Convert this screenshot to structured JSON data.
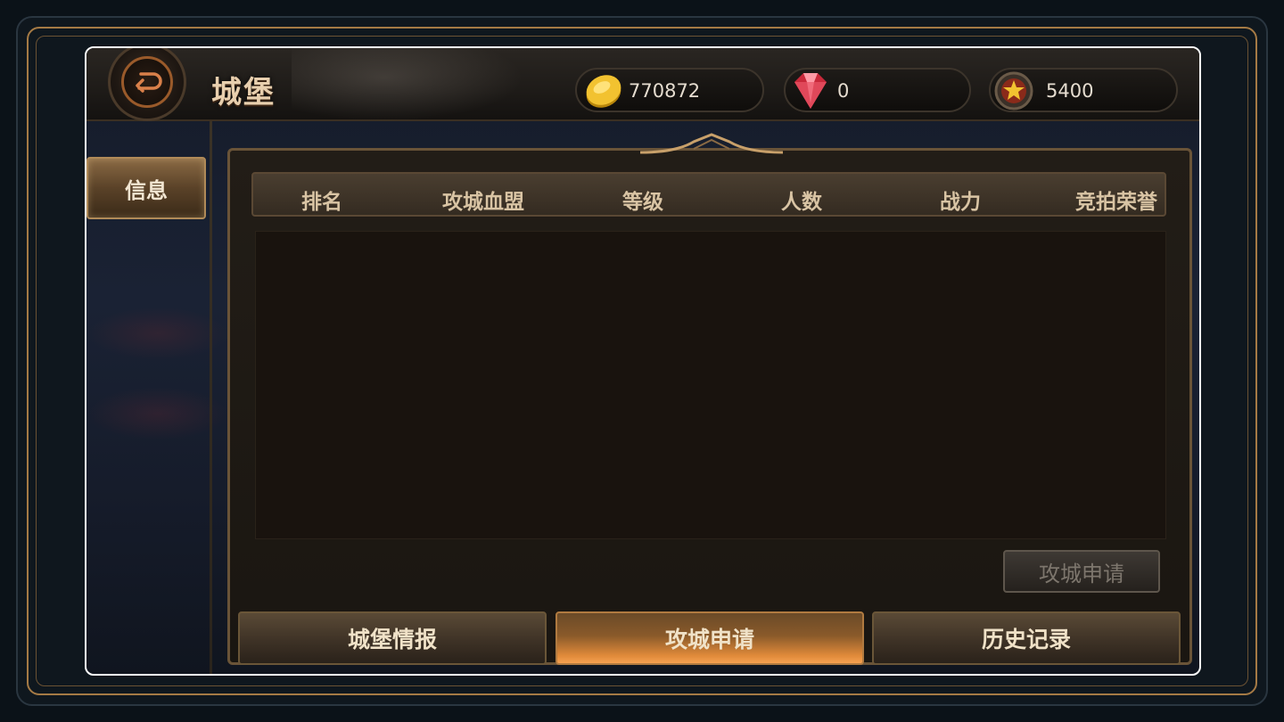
{
  "header": {
    "title": "城堡",
    "back_icon": "back-arrow-icon"
  },
  "resources": [
    {
      "name": "gold",
      "icon": "gold-coin-icon",
      "value": "770872"
    },
    {
      "name": "gem",
      "icon": "red-gem-icon",
      "value": "0"
    },
    {
      "name": "honor",
      "icon": "star-medal-icon",
      "value": "5400"
    }
  ],
  "sidebar": {
    "tabs": [
      {
        "label": "信息",
        "active": true
      }
    ]
  },
  "table": {
    "columns": [
      "排名",
      "攻城血盟",
      "等级",
      "人数",
      "战力",
      "竞拍荣誉"
    ],
    "rows": []
  },
  "actions": {
    "apply_label": "攻城申请"
  },
  "bottom_tabs": [
    {
      "label": "城堡情报",
      "active": false
    },
    {
      "label": "攻城申请",
      "active": true
    },
    {
      "label": "历史记录",
      "active": false
    }
  ],
  "colors": {
    "accent_gold": "#a57a45",
    "active_tab": "#e08a3a"
  }
}
